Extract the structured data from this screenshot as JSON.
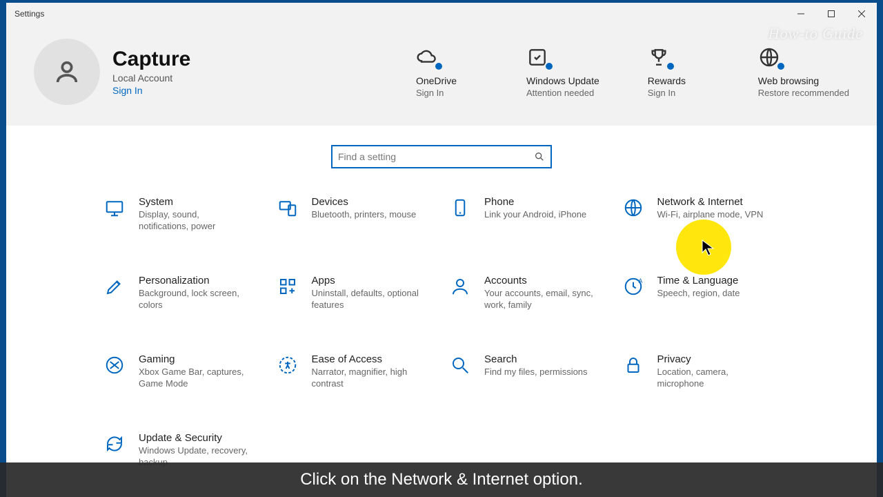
{
  "window": {
    "title": "Settings"
  },
  "profile": {
    "name": "Capture",
    "account_type": "Local Account",
    "signin_label": "Sign In"
  },
  "quick": [
    {
      "id": "onedrive",
      "title": "OneDrive",
      "sub": "Sign In"
    },
    {
      "id": "update",
      "title": "Windows Update",
      "sub": "Attention needed"
    },
    {
      "id": "rewards",
      "title": "Rewards",
      "sub": "Sign In"
    },
    {
      "id": "web",
      "title": "Web browsing",
      "sub": "Restore recommended"
    }
  ],
  "search": {
    "placeholder": "Find a setting"
  },
  "categories": [
    {
      "id": "system",
      "title": "System",
      "desc": "Display, sound, notifications, power"
    },
    {
      "id": "devices",
      "title": "Devices",
      "desc": "Bluetooth, printers, mouse"
    },
    {
      "id": "phone",
      "title": "Phone",
      "desc": "Link your Android, iPhone"
    },
    {
      "id": "network",
      "title": "Network & Internet",
      "desc": "Wi-Fi, airplane mode, VPN"
    },
    {
      "id": "personalization",
      "title": "Personalization",
      "desc": "Background, lock screen, colors"
    },
    {
      "id": "apps",
      "title": "Apps",
      "desc": "Uninstall, defaults, optional features"
    },
    {
      "id": "accounts",
      "title": "Accounts",
      "desc": "Your accounts, email, sync, work, family"
    },
    {
      "id": "time",
      "title": "Time & Language",
      "desc": "Speech, region, date"
    },
    {
      "id": "gaming",
      "title": "Gaming",
      "desc": "Xbox Game Bar, captures, Game Mode"
    },
    {
      "id": "ease",
      "title": "Ease of Access",
      "desc": "Narrator, magnifier, high contrast"
    },
    {
      "id": "search",
      "title": "Search",
      "desc": "Find my files, permissions"
    },
    {
      "id": "privacy",
      "title": "Privacy",
      "desc": "Location, camera, microphone"
    },
    {
      "id": "update",
      "title": "Update & Security",
      "desc": "Windows Update, recovery, backup"
    }
  ],
  "caption": "Click on the Network & Internet option.",
  "watermark": "How-to Guide"
}
